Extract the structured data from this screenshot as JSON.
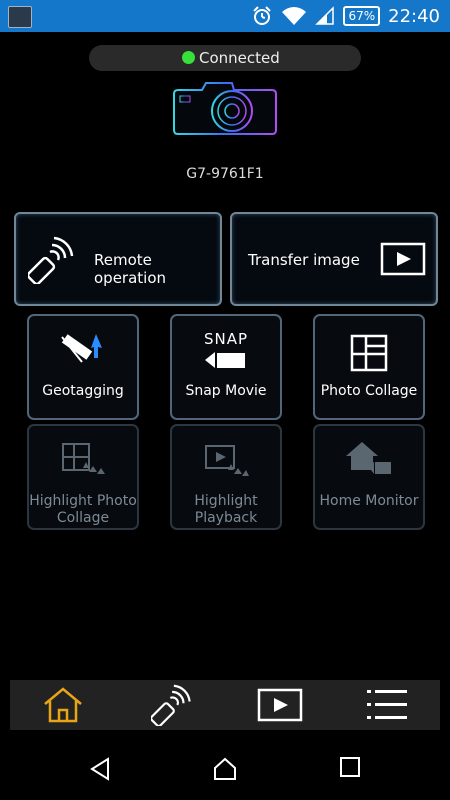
{
  "status_bar": {
    "battery": "67%",
    "time": "22:40"
  },
  "connection": {
    "status": "Connected",
    "indicator_color": "#38e13a"
  },
  "device": {
    "name": "G7-9761F1"
  },
  "main_buttons": [
    {
      "label": "Remote operation",
      "icon": "remote-control-icon"
    },
    {
      "label": "Transfer image",
      "icon": "play-screen-icon"
    }
  ],
  "tiles": [
    {
      "label": "Geotagging",
      "icon": "satellite-icon",
      "enabled": true
    },
    {
      "label": "Snap Movie",
      "badge": "SNAP",
      "icon": "snap-movie-icon",
      "enabled": true
    },
    {
      "label": "Photo Collage",
      "icon": "collage-grid-icon",
      "enabled": true
    },
    {
      "label_line1": "Highlight Photo",
      "label_line2": "Collage",
      "icon": "highlight-collage-icon",
      "enabled": false
    },
    {
      "label_line1": "Highlight",
      "label_line2": "Playback",
      "icon": "highlight-playback-icon",
      "enabled": false
    },
    {
      "label": "Home Monitor",
      "icon": "home-monitor-icon",
      "enabled": false
    }
  ],
  "bottom_nav": [
    {
      "icon": "home-icon",
      "active": true
    },
    {
      "icon": "remote-control-icon",
      "active": false
    },
    {
      "icon": "play-icon",
      "active": false
    },
    {
      "icon": "menu-icon",
      "active": false
    }
  ],
  "colors": {
    "status_bar": "#1577c9",
    "active_nav": "#e8a617",
    "accent_blue": "#2a8cff"
  }
}
